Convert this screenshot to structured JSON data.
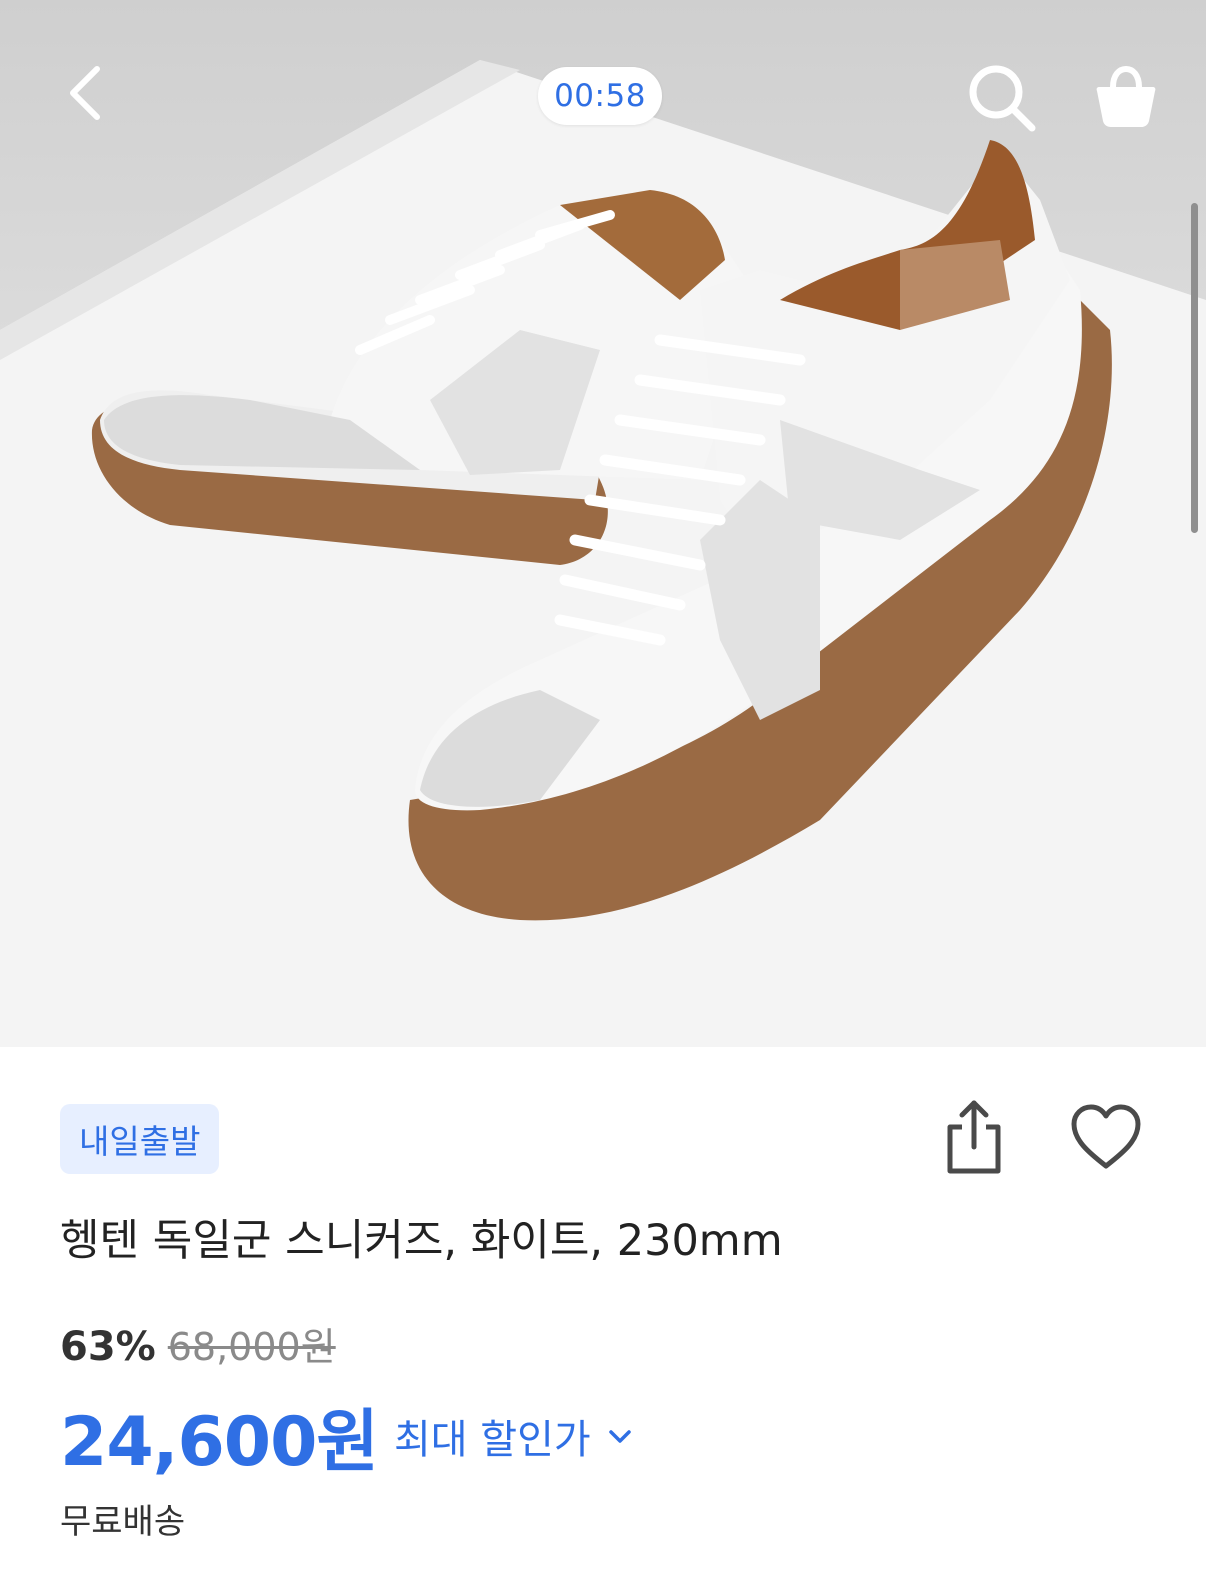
{
  "header": {
    "timer": "00:58"
  },
  "product": {
    "badge": "내일출발",
    "title": "헹텐 독일군 스니커즈, 화이트, 230mm",
    "discount_pct": "63%",
    "original_price": "68,000원",
    "price": "24,600원",
    "max_discount_label": "최대 할인가",
    "shipping": "무료배송"
  },
  "icons": {
    "back": "back-arrow-icon",
    "search": "search-icon",
    "cart": "shopping-bag-icon",
    "share": "share-icon",
    "wishlist": "heart-icon",
    "expand": "chevron-down-icon"
  },
  "colors": {
    "accent": "#2f6fe4",
    "badge_bg": "#e7efff"
  }
}
